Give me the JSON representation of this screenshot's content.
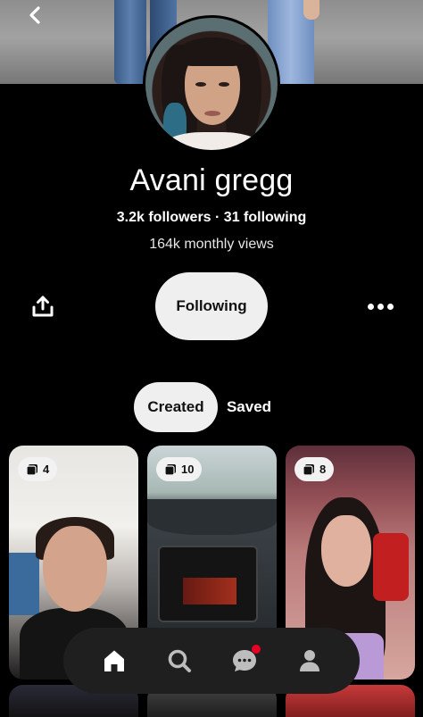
{
  "profile": {
    "name": "Avani gregg",
    "stats": "3.2k followers · 31 following",
    "monthly_views": "164k monthly views"
  },
  "actions": {
    "follow_label": "Following"
  },
  "tabs": [
    {
      "label": "Created",
      "active": true
    },
    {
      "label": "Saved",
      "active": false
    }
  ],
  "pins": [
    {
      "count": "4",
      "icon": "board-icon"
    },
    {
      "count": "10",
      "icon": "board-icon"
    },
    {
      "count": "8",
      "icon": "board-icon"
    }
  ],
  "nav": {
    "items": [
      "home-icon",
      "search-icon",
      "messages-icon",
      "profile-icon"
    ],
    "notification_color": "#e60023"
  },
  "colors": {
    "background": "#000000",
    "pill": "#efefef",
    "nav_bar": "#1f1f1f"
  }
}
